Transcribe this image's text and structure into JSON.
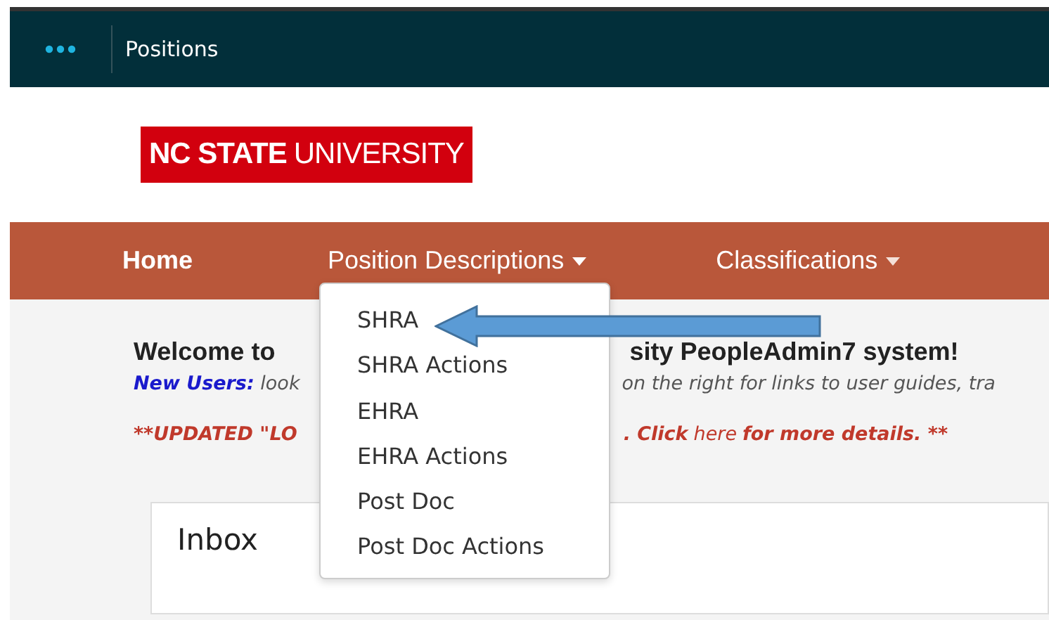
{
  "top_bar": {
    "title": "Positions"
  },
  "logo": {
    "bold": "NC STATE",
    "light": "UNIVERSITY"
  },
  "nav": [
    {
      "label": "Home",
      "selected": true,
      "dropdown": false,
      "expanded": false
    },
    {
      "label": "Position Descriptions",
      "selected": false,
      "dropdown": true,
      "expanded": true
    },
    {
      "label": "Classifications",
      "selected": false,
      "dropdown": true,
      "expanded": false
    }
  ],
  "dropdown_items": [
    "SHRA",
    "SHRA Actions",
    "EHRA",
    "EHRA Actions",
    "Post Doc",
    "Post Doc Actions"
  ],
  "welcome": {
    "left": "Welcome to",
    "right": "sity PeopleAdmin7 system!"
  },
  "new_users": {
    "label": "New Users:",
    "left": "look",
    "right": "on the right for links to user guides, tra"
  },
  "update": {
    "left": "**UPDATED \"LO",
    "right_before": ".  Click",
    "link": "here",
    "right_after": "for more details. **"
  },
  "inbox": {
    "title": "Inbox"
  }
}
